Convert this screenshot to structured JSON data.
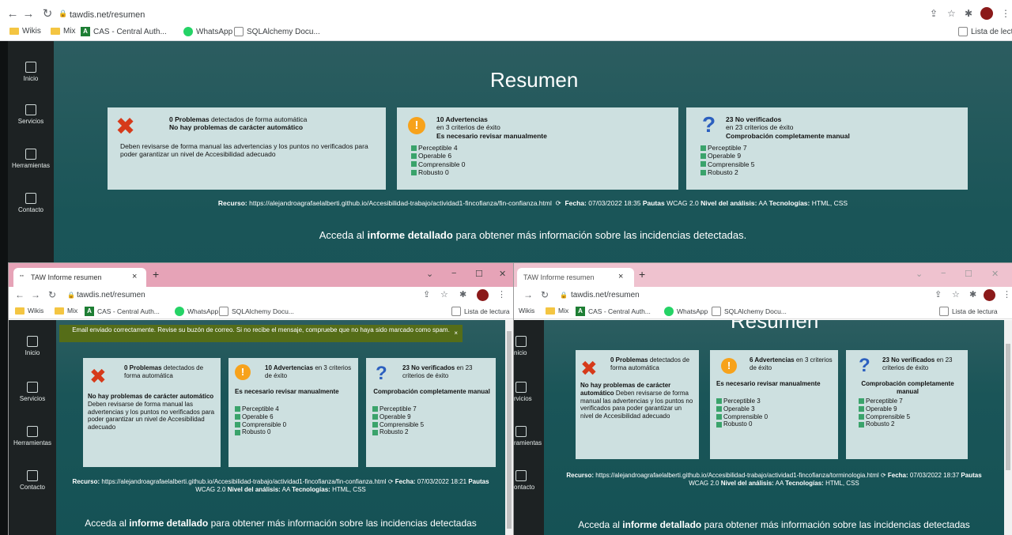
{
  "browser": {
    "url": "tawdis.net/resumen",
    "bookmarks": [
      "Wikis",
      "Mix",
      "CAS - Central Auth...",
      "WhatsApp",
      "SQLAlchemy Docu..."
    ],
    "reading_list": "Lista de lectura",
    "reading_list_cut": "Lista de lectu"
  },
  "sidebar": {
    "items": [
      {
        "label": "Inicio",
        "icon": "home-icon"
      },
      {
        "label": "Servicios",
        "icon": "briefcase-icon"
      },
      {
        "label": "Herramientas",
        "icon": "toolbox-icon"
      },
      {
        "label": "Contacto",
        "icon": "mail-icon"
      }
    ],
    "items_cut": [
      "nicio",
      "rvicios",
      "ramientas",
      "ontacto"
    ]
  },
  "main": {
    "title": "Resumen",
    "title_partial": "Resumen",
    "problems": {
      "count_label": "0 Problemas",
      "rest": "detectados de forma automática",
      "none": "No hay problemas de carácter automático",
      "note": "Deben revisarse de forma manual las advertencias y los puntos no verificados para poder garantizar un nivel de Accesibilidad adecuado"
    },
    "warnings": {
      "count_label": "10 Advertencias",
      "sub": "en 3 criterios de éxito",
      "manual": "Es necesario revisar manualmente",
      "criteria": [
        "Perceptible 4",
        "Operable 6",
        "Comprensible 0",
        "Robusto 0"
      ]
    },
    "unverified": {
      "count_label": "23 No verificados",
      "sub": "en 23 criterios de éxito",
      "manual": "Comprobación completamente manual",
      "criteria": [
        "Perceptible 7",
        "Operable 9",
        "Comprensible 5",
        "Robusto 2"
      ]
    },
    "resource": {
      "label": "Recurso:",
      "url": "https://alejandroagrafaelalberti.github.io/Accesibilidad-trabajo/actividad1-fincofianza/fin-confianza.html",
      "fecha_label": "Fecha:",
      "fecha": "07/03/2022 18:35",
      "pautas_label": "Pautas",
      "pautas": "WCAG 2.0",
      "nivel_label": "Nivel del análisis:",
      "nivel": "AA",
      "tec_label": "Tecnologías:",
      "tec": "HTML, CSS"
    },
    "cta_pre": "Acceda al",
    "cta_bold": "informe detallado",
    "cta_post": "para obtener más información sobre las incidencias detectadas."
  },
  "window_left": {
    "tab_title": "TAW Informe resumen",
    "toast": "Email enviado correctamente. Revise su buzón de correo. Si no recibe el mensaje, compruebe que no haya sido marcado como spam.",
    "problems": {
      "count_label": "0 Problemas",
      "rest": "detectados de forma automática",
      "none": "No hay problemas de carácter automático",
      "note": "Deben revisarse de forma manual las advertencias y los puntos no verificados para poder garantizar un nivel de Accesibilidad adecuado"
    },
    "warnings": {
      "count_label": "10 Advertencias",
      "sub": "en 3 criterios de éxito",
      "manual": "Es necesario revisar manualmente",
      "criteria": [
        "Perceptible 4",
        "Operable 6",
        "Comprensible 0",
        "Robusto 0"
      ]
    },
    "unverified": {
      "count_label": "23 No verificados",
      "sub": "en 23 criterios de éxito",
      "manual": "Comprobación completamente manual",
      "criteria": [
        "Perceptible 7",
        "Operable 9",
        "Comprensible 5",
        "Robusto 2"
      ]
    },
    "resource": {
      "label": "Recurso:",
      "url": "https://alejandroagrafaelalberti.github.io/Accesibilidad-trabajo/actividad1-fincofianza/fin-confianza.html",
      "fecha_label": "Fecha:",
      "fecha": "07/03/2022 18:21",
      "pautas_label": "Pautas",
      "pautas": "WCAG 2.0",
      "nivel_label": "Nivel del análisis:",
      "nivel": "AA",
      "tec_label": "Tecnologías:",
      "tec": "HTML, CSS"
    },
    "cta_pre": "Acceda al",
    "cta_bold": "informe detallado",
    "cta_post": "para obtener más información sobre las incidencias detectadas"
  },
  "window_right": {
    "tab_title": "TAW Informe resumen",
    "problems": {
      "count_label": "0 Problemas",
      "rest": "detectados de forma automática",
      "none": "No hay problemas de carácter automático",
      "note": "Deben revisarse de forma manual las advertencias y los puntos no verificados para poder garantizar un nivel de Accesibilidad adecuado"
    },
    "warnings": {
      "count_label": "6 Advertencias",
      "sub": "en 3 criterios de éxito",
      "manual": "Es necesario revisar manualmente",
      "criteria": [
        "Perceptible 3",
        "Operable 3",
        "Comprensible 0",
        "Robusto 0"
      ]
    },
    "unverified": {
      "count_label": "23 No verificados",
      "sub": "en 23 criterios de éxito",
      "manual": "Comprobación completamente manual",
      "criteria": [
        "Perceptible 7",
        "Operable 9",
        "Comprensible 5",
        "Robusto 2"
      ]
    },
    "resource": {
      "label": "Recurso:",
      "url": "https://alejandroagrafaelalberti.github.io/Accesibilidad-trabajo/actividad1-fincofianza/torminologia.html",
      "fecha_label": "Fecha:",
      "fecha": "07/03/2022 18:37",
      "pautas_label": "Pautas",
      "pautas": "WCAG 2.0",
      "nivel_label": "Nivel del análisis:",
      "nivel": "AA",
      "tec_label": "Tecnologías:",
      "tec": "HTML, CSS"
    },
    "cta_pre": "Acceda al",
    "cta_bold": "informe detallado",
    "cta_post": "para obtener más información sobre las incidencias detectadas"
  },
  "colors": {
    "teal": "#155255",
    "sidebar": "#1d2223",
    "card": "#cde0e0",
    "tab_strip": "#e6a3b7",
    "toast": "#556d18",
    "error": "#d63a1a",
    "warning": "#f7a21b",
    "info": "#2b5fbf"
  }
}
